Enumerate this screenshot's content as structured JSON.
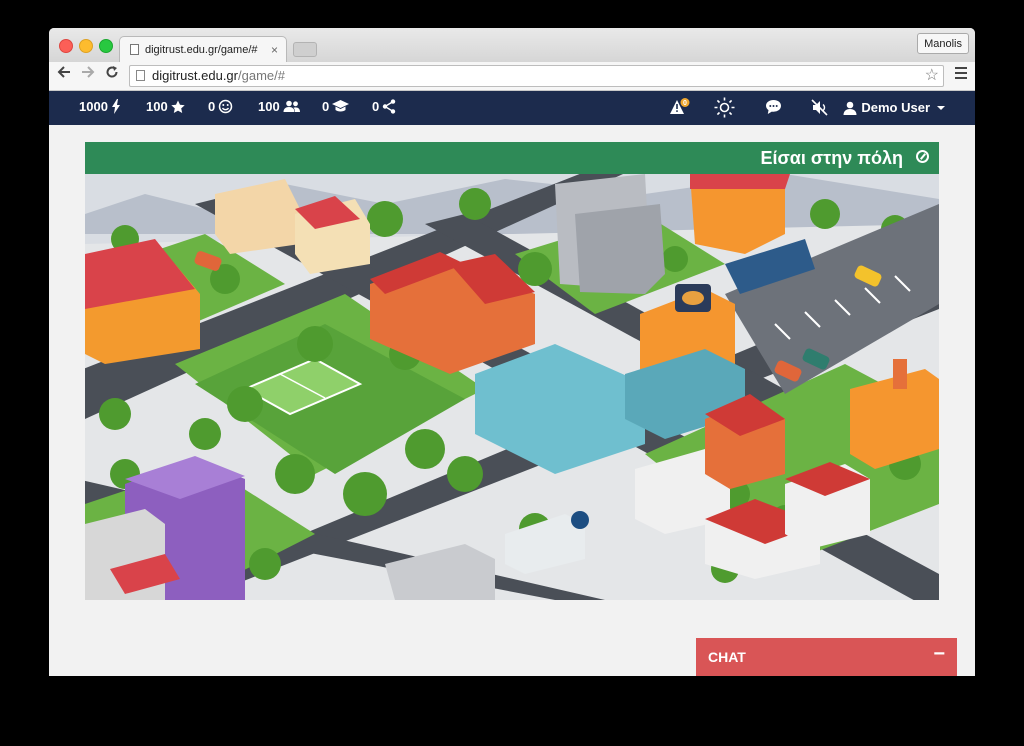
{
  "browser": {
    "tab_title": "digitrust.edu.gr/game/#",
    "tab_close": "×",
    "profile_name": "Manolis",
    "url_host": "digitrust.edu.gr",
    "url_path": "/game/#",
    "back_icon": "arrow-left-icon",
    "forward_icon": "arrow-right-icon",
    "reload_icon": "reload-icon",
    "star_icon": "star-outline-icon"
  },
  "nav": {
    "energy": "1000",
    "stars": "100",
    "smileys": "0",
    "people": "100",
    "education": "0",
    "shares": "0",
    "notification_count": "0",
    "user_name": "Demo User"
  },
  "panel": {
    "title": "Είσαι στην πόλη",
    "header_color": "#2e8a57"
  },
  "chat": {
    "label": "CHAT",
    "minimize": "−",
    "color": "#d95556"
  },
  "colors": {
    "navbar": "#1c2b4d",
    "road": "#4a4f57",
    "grass": "#6bb344"
  }
}
